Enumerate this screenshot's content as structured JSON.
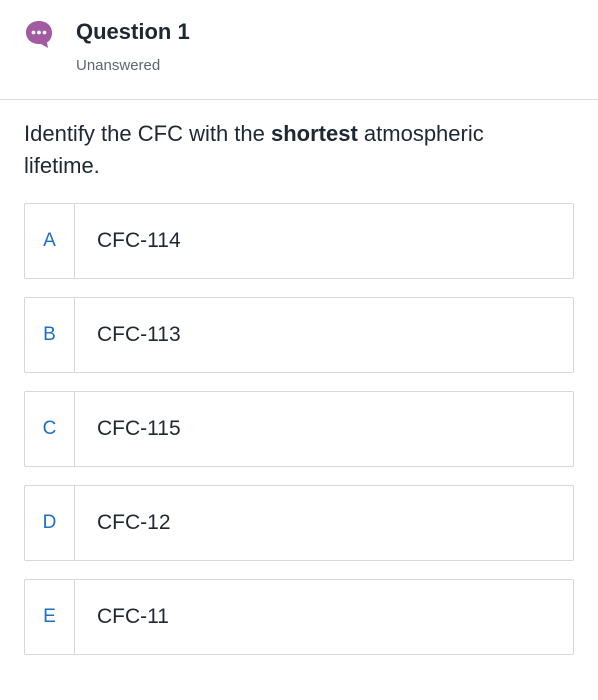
{
  "header": {
    "icon": "chat-bubble-ellipsis-icon",
    "icon_color": "#a45aa0",
    "title": "Question 1",
    "status": "Unanswered"
  },
  "question": {
    "text_before": "Identify the CFC with the ",
    "text_bold": "shortest",
    "text_after": " atmospheric lifetime."
  },
  "options": [
    {
      "letter": "A",
      "text": "CFC-114"
    },
    {
      "letter": "B",
      "text": "CFC-113"
    },
    {
      "letter": "C",
      "text": "CFC-115"
    },
    {
      "letter": "D",
      "text": "CFC-12"
    },
    {
      "letter": "E",
      "text": "CFC-11"
    }
  ],
  "colors": {
    "letter": "#1c6fc2",
    "border": "#d4d7db"
  }
}
